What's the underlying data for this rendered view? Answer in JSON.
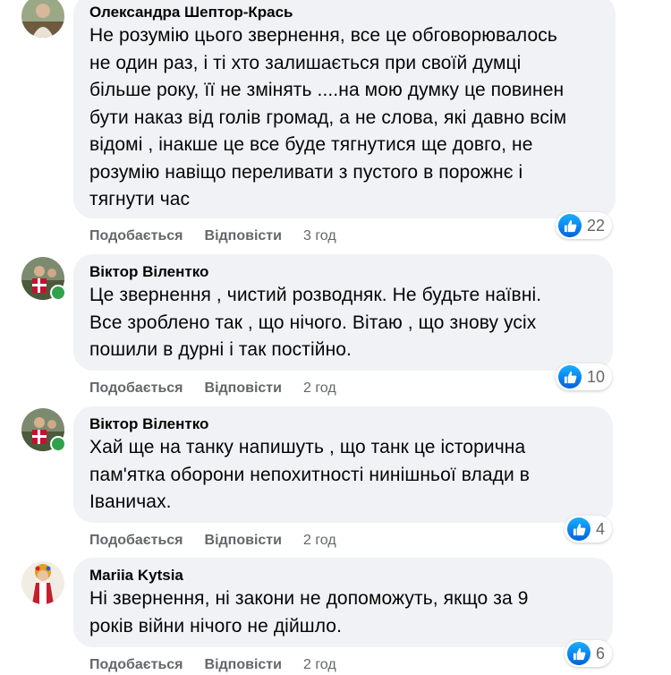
{
  "comments": [
    {
      "author": "Олександра Шептор-Крась",
      "lines": [
        "Не розумію цього звернення, все це обговорювалось",
        "не один раз, і ті хто залишається при своїй думці",
        "більше року, її не змінять ....на мою думку це повинен",
        "бути наказ від голів громад, а не слова, які давно всім",
        "відомі , інакше це все буде тягнутися ще довго, не",
        "розумію навіщо переливати з пустого в порожнє і",
        "тягнути час"
      ],
      "reaction_count": "22",
      "like_label": "Подобається",
      "reply_label": "Відповісти",
      "time": "3 год"
    },
    {
      "author": "Віктор Вілентко",
      "lines": [
        "Це звернення , чистий розводняк. Не будьте наївні.",
        "Все зроблено так , що нічого. Вітаю , що знову усіх",
        "пошили в дурні і так постійно."
      ],
      "reaction_count": "10",
      "like_label": "Подобається",
      "reply_label": "Відповісти",
      "time": "2 год"
    },
    {
      "author": "Віктор Вілентко",
      "lines": [
        "Хай ще на танку напишуть , що танк це історична",
        "пам'ятка оборони непохитності нинішньої влади в",
        "Іваничах."
      ],
      "reaction_count": "4",
      "like_label": "Подобається",
      "reply_label": "Відповісти",
      "time": "2 год"
    },
    {
      "author": "Mariia Kytsia",
      "lines": [
        "Ні звернення, ні закони не допоможуть, якщо за 9",
        "років війни нічого не дійшло."
      ],
      "reaction_count": "6",
      "like_label": "Подобається",
      "reply_label": "Відповісти",
      "time": "2 год"
    }
  ],
  "colors": {
    "bubble": "#f0f2f5",
    "text": "#050505",
    "secondary": "#65676b",
    "like_blue": "#0866ff",
    "online": "#31a24c"
  }
}
